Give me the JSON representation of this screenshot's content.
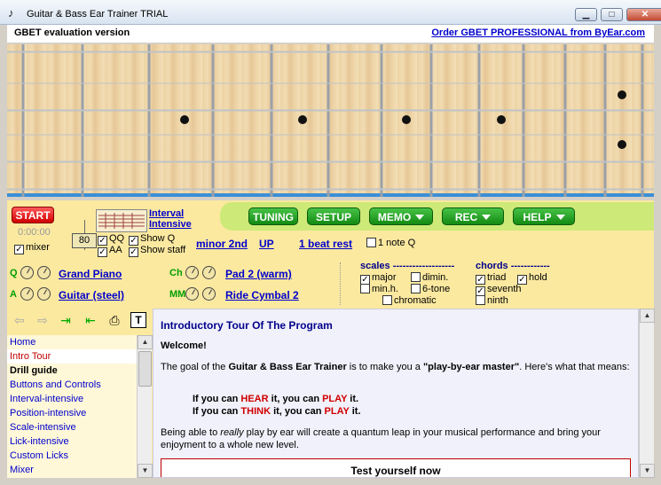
{
  "window": {
    "title": "Guitar & Bass Ear Trainer TRIAL",
    "minimize": "▁",
    "maximize": "□",
    "close": "✕"
  },
  "evalbar": {
    "eval_text": "GBET evaluation version",
    "order_link": "Order GBET PROFESSIONAL from ByEar.com"
  },
  "controls": {
    "start": "START",
    "timer": "0:00:00",
    "mixer": "mixer",
    "bpm": "80",
    "interval_line1": "Interval",
    "interval_line2": "Intensive",
    "qq": "QQ",
    "aa": "AA",
    "show_q": "Show Q",
    "show_staff": "Show staff",
    "interval_value": "minor 2nd",
    "direction": "UP",
    "rest": "1 beat rest",
    "one_note_q": "1 note Q",
    "buttons": {
      "tuning": "TUNING",
      "setup": "SETUP",
      "memo": "MEMO",
      "rec": "REC",
      "help": "HELP"
    }
  },
  "instruments": {
    "q_label": "Q",
    "q_instrument": "Grand Piano",
    "a_label": "A",
    "a_instrument": "Guitar (steel)",
    "ch_label": "Ch",
    "ch_instrument": "Pad 2 (warm)",
    "mm_label": "MM",
    "mm_instrument": "Ride Cymbal 2"
  },
  "scales": {
    "heading": "scales -------------------",
    "major": "major",
    "dimin": "dimin.",
    "minh": "min.h.",
    "sixtone": "6-tone",
    "chromatic": "chromatic"
  },
  "chords": {
    "heading": "chords ------------",
    "triad": "triad",
    "hold": "hold",
    "seventh": "seventh",
    "ninth": "ninth"
  },
  "nav": {
    "items": [
      {
        "label": "Home"
      },
      {
        "label": "Intro Tour"
      },
      {
        "label": "Drill guide"
      },
      {
        "label": "Buttons and Controls"
      },
      {
        "label": "Interval-intensive"
      },
      {
        "label": "Position-intensive"
      },
      {
        "label": "Scale-intensive"
      },
      {
        "label": "Lick-intensive"
      },
      {
        "label": "Custom Licks"
      },
      {
        "label": "Mixer"
      }
    ]
  },
  "content": {
    "title": "Introductory Tour Of The Program",
    "welcome": "Welcome!",
    "p1_a": "The goal of the ",
    "p1_b": "Guitar & Bass Ear Trainer",
    "p1_c": " is to make you a ",
    "p1_d": "\"play-by-ear master\"",
    "p1_e": ". Here's what that means:",
    "l1_a": "If you can ",
    "l1_b": "HEAR",
    "l1_c": " it, you can ",
    "l1_d": "PLAY",
    "l1_e": " it.",
    "l2_a": "If you can ",
    "l2_b": "THINK",
    "l2_c": " it, you can ",
    "l2_d": "PLAY",
    "l2_e": " it.",
    "p2_a": "Being able to ",
    "p2_b": "really",
    "p2_c": " play by ear will create a quantum leap in your musical performance and bring your enjoyment to a whole new level.",
    "box": "Test yourself now"
  }
}
